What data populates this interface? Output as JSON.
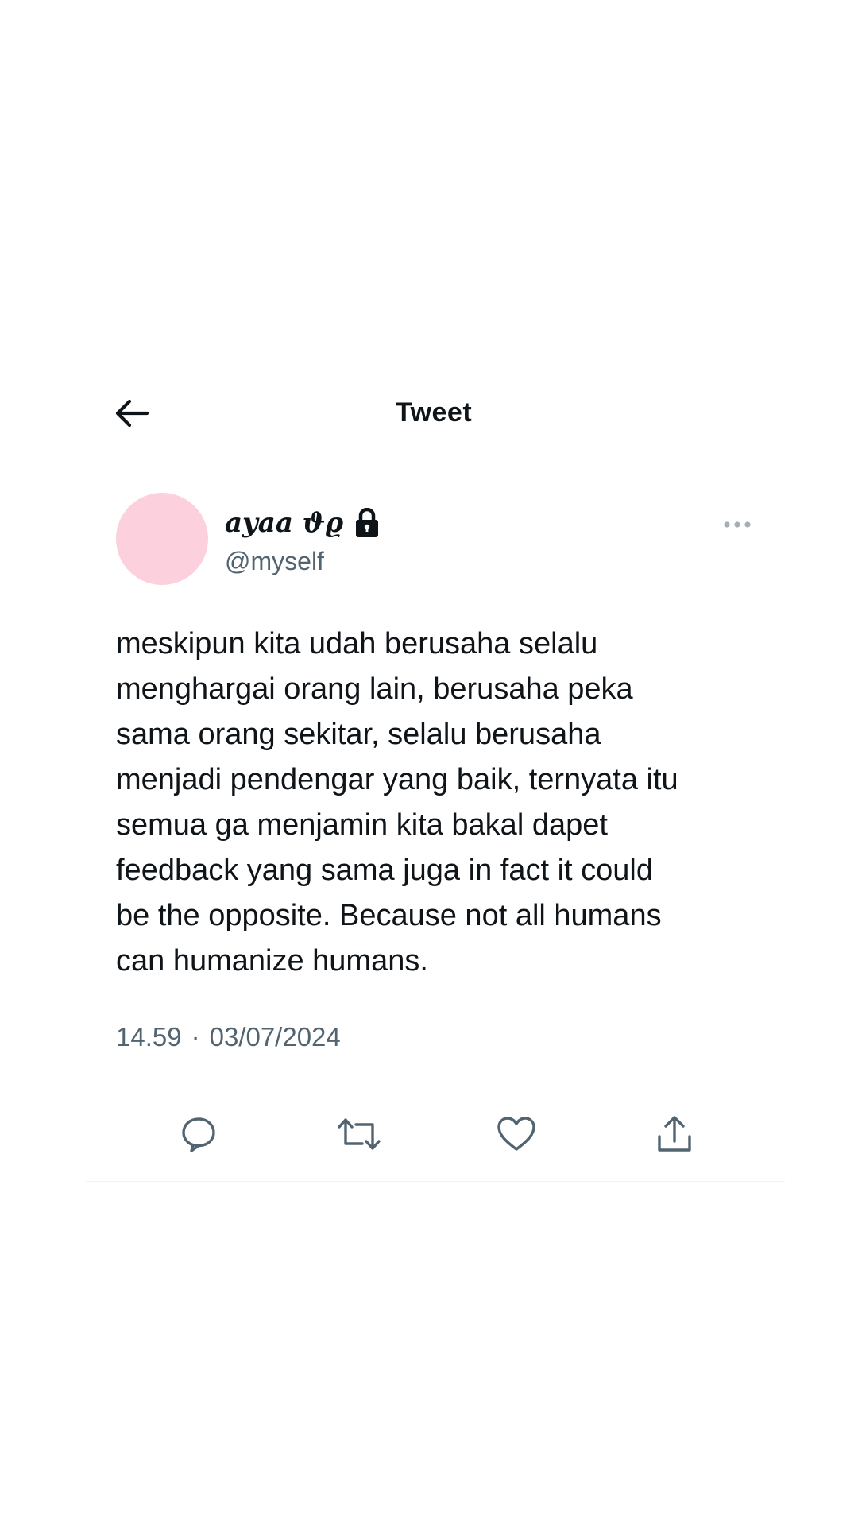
{
  "header": {
    "title": "Tweet",
    "back_icon": "arrow-left-icon"
  },
  "author": {
    "display_name": "ayaa ϑϱ",
    "handle": "@myself",
    "protected_icon": "lock-icon",
    "avatar_color": "#fdd0dd"
  },
  "tweet": {
    "text": "meskipun kita udah berusaha selalu\nmenghargai orang lain, berusaha peka\nsama orang sekitar, selalu berusaha\nmenjadi pendengar yang baik, ternyata itu\nsemua ga menjamin kita bakal dapet\nfeedback yang sama juga in fact it could\nbe the opposite. Because not all humans\ncan humanize humans.",
    "time": "14.59",
    "separator": "·",
    "date": "03/07/2024"
  },
  "actions": [
    {
      "name": "reply",
      "icon": "speech-bubble-icon"
    },
    {
      "name": "retweet",
      "icon": "retweet-icon"
    },
    {
      "name": "like",
      "icon": "heart-icon"
    },
    {
      "name": "share",
      "icon": "share-upload-icon"
    }
  ],
  "colors": {
    "text_primary": "#0f1419",
    "text_secondary": "#536471",
    "divider": "#eff3f4"
  }
}
